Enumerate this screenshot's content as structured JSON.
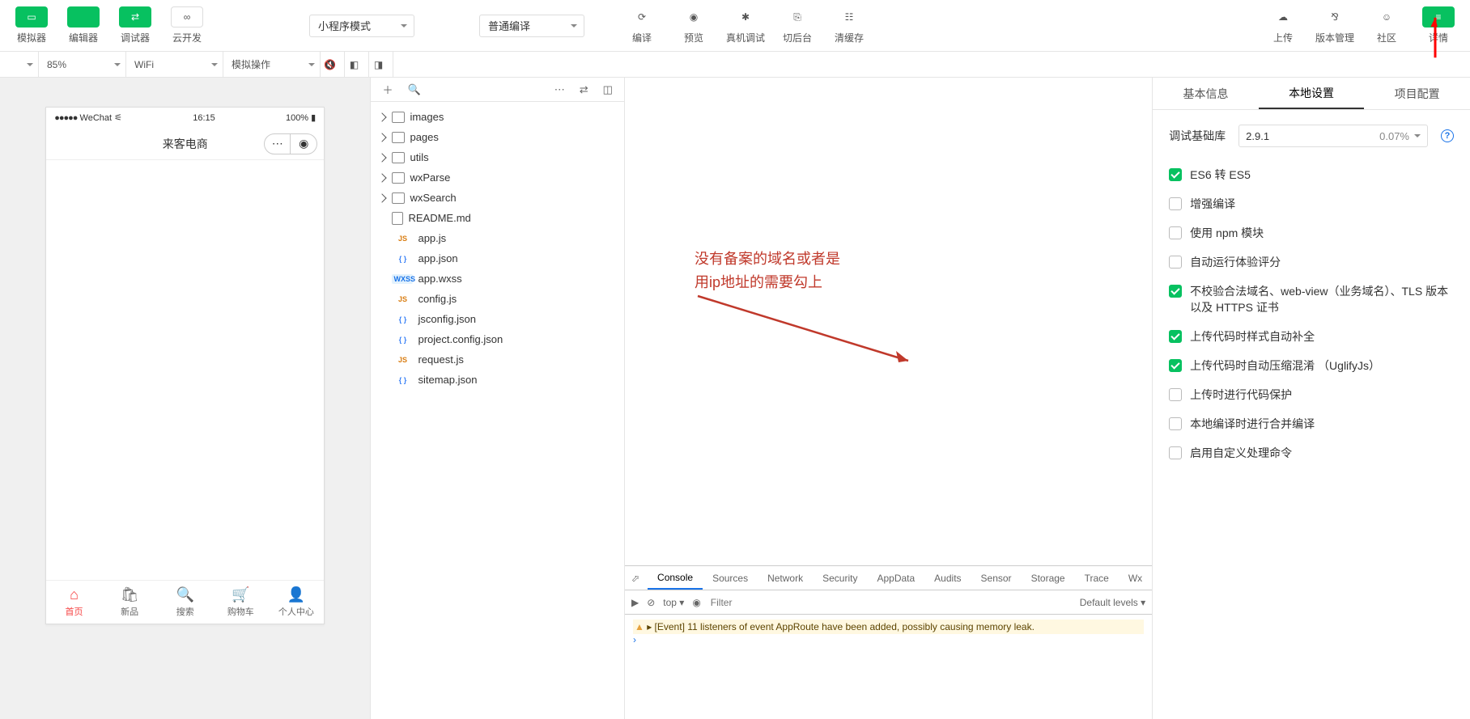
{
  "toolbar_left": [
    {
      "label": "模拟器",
      "green": true,
      "icon": "▭"
    },
    {
      "label": "编辑器",
      "green": true,
      "icon": "</>"
    },
    {
      "label": "调试器",
      "green": true,
      "icon": "⇄"
    },
    {
      "label": "云开发",
      "green": false,
      "icon": "∞"
    }
  ],
  "dropdown_mode": "小程序模式",
  "dropdown_compile": "普通编译",
  "toolbar_mid": [
    {
      "label": "编译",
      "icon": "⟳"
    },
    {
      "label": "预览",
      "icon": "◉"
    },
    {
      "label": "真机调试",
      "icon": "✱"
    },
    {
      "label": "切后台",
      "icon": "⎘"
    },
    {
      "label": "清缓存",
      "icon": "☷"
    }
  ],
  "toolbar_right": [
    {
      "label": "上传",
      "icon": "☁"
    },
    {
      "label": "版本管理",
      "icon": "⅋"
    },
    {
      "label": "社区",
      "icon": "☺"
    },
    {
      "label": "详情",
      "green": true,
      "icon": "≡"
    }
  ],
  "subbar": {
    "zoom": "85%",
    "network": "WiFi",
    "mock": "模拟操作"
  },
  "simulator": {
    "carrier": "WeChat",
    "time": "16:15",
    "battery": "100%",
    "title": "来客电商",
    "tabs": [
      {
        "label": "首页",
        "icon": "⌂",
        "active": true
      },
      {
        "label": "新品",
        "icon": "🛍"
      },
      {
        "label": "搜索",
        "icon": "🔍"
      },
      {
        "label": "购物车",
        "icon": "🛒"
      },
      {
        "label": "个人中心",
        "icon": "👤"
      }
    ]
  },
  "tree": {
    "folders": [
      "images",
      "pages",
      "utils",
      "wxParse",
      "wxSearch"
    ],
    "files": [
      {
        "name": "README.md",
        "type": "file"
      },
      {
        "name": "app.js",
        "type": "js"
      },
      {
        "name": "app.json",
        "type": "json"
      },
      {
        "name": "app.wxss",
        "type": "wxss"
      },
      {
        "name": "config.js",
        "type": "js"
      },
      {
        "name": "jsconfig.json",
        "type": "json"
      },
      {
        "name": "project.config.json",
        "type": "json"
      },
      {
        "name": "request.js",
        "type": "js"
      },
      {
        "name": "sitemap.json",
        "type": "json"
      }
    ]
  },
  "annotation": {
    "line1": "没有备案的域名或者是",
    "line2": "用ip地址的需要勾上"
  },
  "devtools": {
    "tabs": [
      "Console",
      "Sources",
      "Network",
      "Security",
      "AppData",
      "Audits",
      "Sensor",
      "Storage",
      "Trace",
      "Wx"
    ],
    "active_tab": "Console",
    "context": "top",
    "filter_placeholder": "Filter",
    "levels": "Default levels ▾",
    "warn": "[Event] 11 listeners of event AppRoute have been added, possibly causing memory leak."
  },
  "right": {
    "tabs": [
      "基本信息",
      "本地设置",
      "项目配置"
    ],
    "active_tab": "本地设置",
    "lib_label": "调试基础库",
    "lib_version": "2.9.1",
    "lib_percent": "0.07%",
    "checks": [
      {
        "label": "ES6 转 ES5",
        "on": true
      },
      {
        "label": "增强编译",
        "on": false
      },
      {
        "label": "使用 npm 模块",
        "on": false
      },
      {
        "label": "自动运行体验评分",
        "on": false
      },
      {
        "label": "不校验合法域名、web-view（业务域名）、TLS 版本以及 HTTPS 证书",
        "on": true
      },
      {
        "label": "上传代码时样式自动补全",
        "on": true
      },
      {
        "label": "上传代码时自动压缩混淆 （UglifyJs）",
        "on": true
      },
      {
        "label": "上传时进行代码保护",
        "on": false
      },
      {
        "label": "本地编译时进行合并编译",
        "on": false
      },
      {
        "label": "启用自定义处理命令",
        "on": false
      }
    ]
  }
}
